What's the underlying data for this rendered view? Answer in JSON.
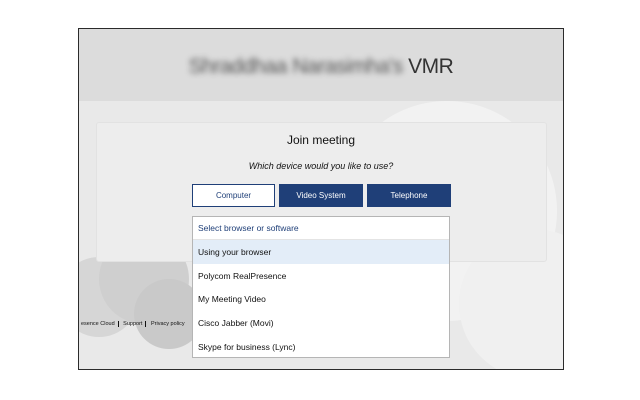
{
  "header": {
    "owner_name": "Shraddhaa Narasimha's",
    "suffix": "VMR"
  },
  "join": {
    "title": "Join meeting",
    "question": "Which device would you like to use?"
  },
  "device_buttons": {
    "computer": "Computer",
    "video_system": "Video System",
    "telephone": "Telephone"
  },
  "dropdown": {
    "placeholder": "Select browser or software",
    "items": [
      "Using your browser",
      "Polycom RealPresence",
      "My Meeting Video",
      "Cisco Jabber (Movi)",
      "Skype for business (Lync)"
    ]
  },
  "footer": {
    "links": [
      "esence Cloud",
      "Support",
      "Privacy policy"
    ]
  },
  "colors": {
    "brand_blue": "#1f3f78",
    "highlight": "#e3edf8",
    "background": "#e9e9e9"
  }
}
